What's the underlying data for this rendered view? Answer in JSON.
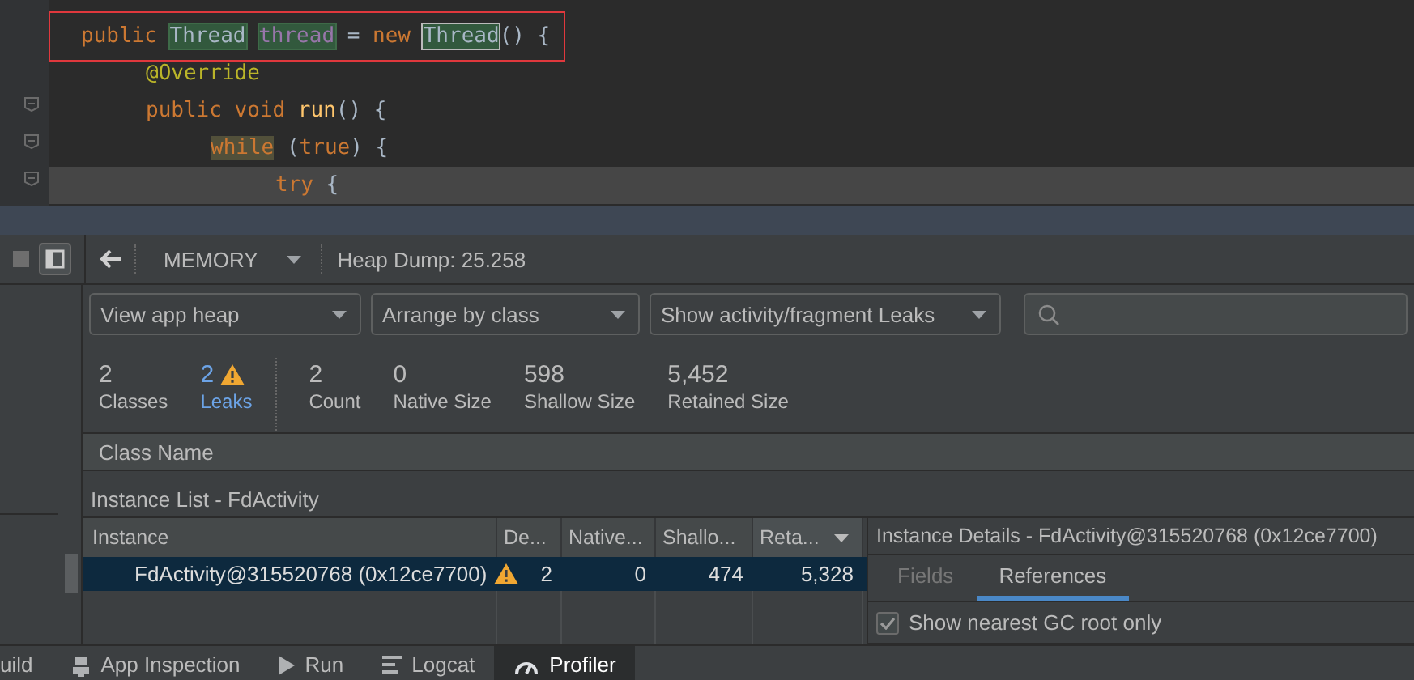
{
  "editor": {
    "lines": [
      {
        "framed": true,
        "current": false,
        "tokens": [
          {
            "text": "public ",
            "kind": "keyword"
          },
          {
            "text": "Thread",
            "kind": "type-usage"
          },
          {
            "text": "thread",
            "kind": "field-usage"
          },
          {
            "text": " = ",
            "kind": "plain"
          },
          {
            "text": "new ",
            "kind": "keyword"
          },
          {
            "text": "Thread",
            "kind": "type-boxed"
          },
          {
            "text": "() {",
            "kind": "plain"
          }
        ],
        "children": [
          {
            "framed": false,
            "current": false,
            "tokens": [
              {
                "text": "@Override",
                "kind": "annotation"
              }
            ]
          },
          {
            "framed": false,
            "current": false,
            "tokens": [
              {
                "text": "public void ",
                "kind": "keyword"
              },
              {
                "text": "run",
                "kind": "method"
              },
              {
                "text": "() {",
                "kind": "plain"
              }
            ],
            "children": [
              {
                "framed": false,
                "current": false,
                "tokens": [
                  {
                    "text": "while",
                    "kind": "keyword-usage"
                  },
                  {
                    "text": " (",
                    "kind": "plain"
                  },
                  {
                    "text": "true",
                    "kind": "keyword"
                  },
                  {
                    "text": ") {",
                    "kind": "plain"
                  }
                ],
                "children": [
                  {
                    "framed": false,
                    "current": true,
                    "tokens": [
                      {
                        "text": "try",
                        "kind": "keyword"
                      },
                      {
                        "text": " {",
                        "kind": "plain"
                      }
                    ]
                  }
                ]
              }
            ]
          }
        ]
      }
    ]
  },
  "toolbar": {
    "profiler": "MEMORY",
    "title": "Heap Dump: 25.258"
  },
  "filters": {
    "heap": "View app heap",
    "arrange": "Arrange by class",
    "leaks": "Show activity/fragment Leaks"
  },
  "stats": [
    {
      "value": "2",
      "label": "Classes",
      "warning": false
    },
    {
      "value": "2",
      "label": "Leaks",
      "warning": true
    },
    {
      "value": "2",
      "label": "Count",
      "warning": false
    },
    {
      "value": "0",
      "label": "Native Size",
      "warning": false
    },
    {
      "value": "598",
      "label": "Shallow Size",
      "warning": false
    },
    {
      "value": "5,452",
      "label": "Retained Size",
      "warning": false
    }
  ],
  "class_table": {
    "columns": [
      "Class Name"
    ]
  },
  "instance_list": {
    "title": "Instance List - FdActivity",
    "columns": [
      {
        "label": "Instance",
        "sorted": false
      },
      {
        "label": "De...",
        "sorted": false
      },
      {
        "label": "Native...",
        "sorted": false
      },
      {
        "label": "Shallo...",
        "sorted": false
      },
      {
        "label": "Reta...",
        "sorted": true
      }
    ],
    "rows": [
      {
        "selected": true,
        "leak": true,
        "cells": [
          "FdActivity@315520768 (0x12ce7700)",
          "2",
          "0",
          "474",
          "5,328"
        ]
      }
    ]
  },
  "details": {
    "title": "Instance Details - FdActivity@315520768 (0x12ce7700)",
    "tabs": [
      {
        "label": "Fields",
        "selected": false
      },
      {
        "label": "References",
        "selected": true
      }
    ],
    "gc_root_only": {
      "label": "Show nearest GC root only",
      "checked": true
    }
  },
  "bottom_tabs": [
    {
      "label": "uild",
      "selected": false
    },
    {
      "label": "App Inspection",
      "selected": false
    },
    {
      "label": "Run",
      "selected": false
    },
    {
      "label": "Logcat",
      "selected": false
    },
    {
      "label": "Profiler",
      "selected": true
    }
  ]
}
